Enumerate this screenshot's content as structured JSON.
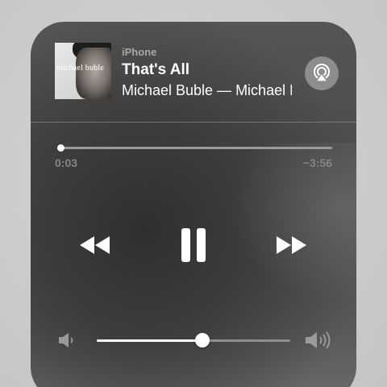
{
  "now_playing": {
    "source": "iPhone",
    "title": "That's All",
    "subtitle": "Michael Buble — Michael Bublé",
    "album_art": {
      "text": "michael buble",
      "icon": "album-art"
    }
  },
  "airplay": {
    "icon": "airplay-icon",
    "color": "#8d8d8d"
  },
  "progress": {
    "elapsed": "0:03",
    "remaining": "−3:56",
    "fraction": 0.013
  },
  "controls": {
    "rewind_icon": "rewind-icon",
    "pause_icon": "pause-icon",
    "forward_icon": "fast-forward-icon"
  },
  "volume": {
    "level": 0.545,
    "low_icon": "volume-low-icon",
    "high_icon": "volume-high-icon"
  },
  "colors": {
    "accent": "#ffffff",
    "secondary_text": "#a8a8a8",
    "time_text": "#858585"
  }
}
